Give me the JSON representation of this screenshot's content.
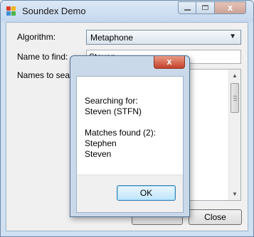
{
  "window": {
    "title": "Soundex Demo",
    "icon": "app-grid-icon",
    "controls": {
      "close": "x"
    }
  },
  "form": {
    "algorithm_label": "Algorithm:",
    "algorithm_value": "Metaphone",
    "name_label": "Name to find:",
    "name_value": "Steven",
    "names_label": "Names to search:",
    "close_button": "Close"
  },
  "dialog": {
    "close_glyph": "x",
    "lines": [
      "Searching for:",
      "Steven (STFN)",
      "",
      "Matches found (2):",
      "Stephen",
      "Steven"
    ],
    "ok_button": "OK"
  },
  "colors": {
    "title_bar": "#c5d8ee",
    "close_button": "#c4412a",
    "ok_button_border": "#3c7fb1"
  }
}
